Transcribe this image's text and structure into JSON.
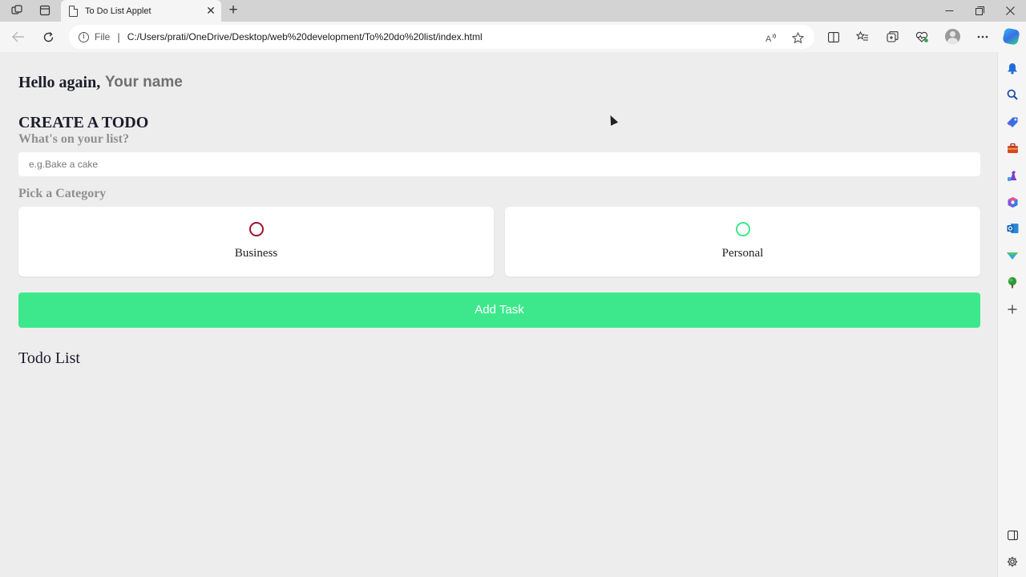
{
  "browser": {
    "tab_title": "To Do List Applet",
    "tab_close": "✕",
    "new_tab": "+",
    "address": {
      "scheme_label": "File",
      "separator": "|",
      "url": "C:/Users/prati/OneDrive/Desktop/web%20development/To%20do%20list/index.html"
    },
    "icons": {
      "workspaces": "workspaces-icon",
      "tab_actions": "tab-actions-icon",
      "minimize": "minimize-icon",
      "maximize": "maximize-icon",
      "close": "close-icon",
      "back": "back-arrow-icon",
      "refresh": "refresh-icon",
      "info": "info-icon",
      "read_aloud": "read-aloud-icon",
      "favorite": "star-icon",
      "split_screen": "split-screen-icon",
      "favorites": "favorites-icon",
      "collections": "collections-icon",
      "browser_essentials": "heart-pulse-icon",
      "profile": "avatar",
      "more": "more-icon",
      "copilot": "copilot-icon"
    },
    "sidebar_icons": [
      "bell-icon",
      "search-icon",
      "shopping-tag-icon",
      "toolbox-icon",
      "chess-icon",
      "office-icon",
      "outlook-icon",
      "drop-icon",
      "tree-icon",
      "add-icon",
      "sidebar-toggle-icon",
      "settings-icon"
    ]
  },
  "page": {
    "greeting": "Hello again,",
    "name_placeholder": "Your name",
    "create_title": "CREATE A TODO",
    "question": "What's on your list?",
    "todo_placeholder": "e.g.Bake a cake",
    "category_label": "Pick a Category",
    "categories": [
      {
        "label": "Business",
        "color": "#a3122b"
      },
      {
        "label": "Personal",
        "color": "#3de88c"
      }
    ],
    "add_button": "Add Task",
    "list_title": "Todo List"
  }
}
